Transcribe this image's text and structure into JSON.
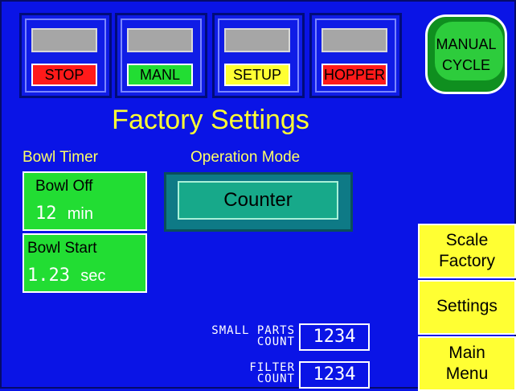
{
  "status": [
    {
      "label": "STOP",
      "color": "#ff1a1a",
      "text_color": "#000000"
    },
    {
      "label": "MANL",
      "color": "#22dd33",
      "text_color": "#000000"
    },
    {
      "label": "SETUP",
      "color": "#ffff33",
      "text_color": "#000000"
    },
    {
      "label": "HOPPER",
      "color": "#ff1a1a",
      "text_color": "#000000"
    }
  ],
  "manual_cycle": {
    "line1": "MANUAL",
    "line2": "CYCLE"
  },
  "title": "Factory Settings",
  "bowl_timer": {
    "section_label": "Bowl Timer",
    "bowl_off": {
      "caption": "Bowl Off",
      "value": "12",
      "unit": "min"
    },
    "bowl_start": {
      "caption": "Bowl Start",
      "value": "1.23",
      "unit": "sec"
    }
  },
  "operation_mode": {
    "section_label": "Operation Mode",
    "value": "Counter"
  },
  "counts": {
    "small_parts": {
      "label_line1": "SMALL PARTS",
      "label_line2": "COUNT",
      "value": "1234"
    },
    "filter": {
      "label_line1": "FILTER",
      "label_line2": "COUNT",
      "value": "1234"
    }
  },
  "side_buttons": {
    "scale_factory": {
      "line1": "Scale",
      "line2": "Factory"
    },
    "settings": {
      "label": "Settings"
    },
    "main_menu": {
      "line1": "Main",
      "line2": "Menu"
    }
  }
}
